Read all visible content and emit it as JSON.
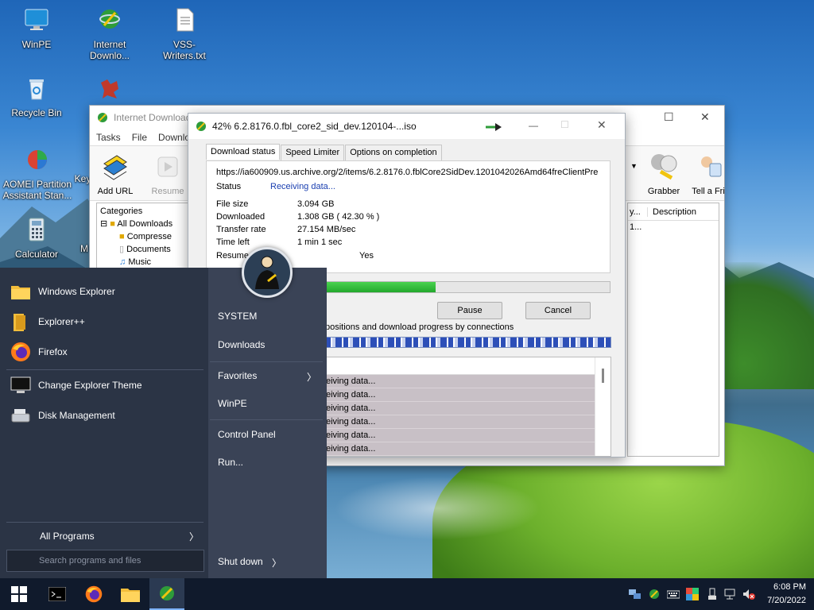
{
  "desktop": {
    "icons": [
      {
        "label": "WinPE",
        "icon": "monitor-icon"
      },
      {
        "label": "Internet Downlo...",
        "icon": "idm-globe-icon"
      },
      {
        "label": "VSS-Writers.txt",
        "icon": "text-file-icon"
      },
      {
        "label": "Recycle Bin",
        "icon": "recycle-bin-icon"
      },
      {
        "label": "",
        "icon": "puzzle-tool-icon"
      },
      {
        "label": "AOMEI Partition Assistant Stan...",
        "icon": "aomei-icon"
      },
      {
        "label": "Key",
        "icon": "key-icon"
      },
      {
        "label": "Calculator",
        "icon": "calculator-icon"
      },
      {
        "label": "M",
        "icon": "app-icon"
      }
    ]
  },
  "idm_main": {
    "title": "Internet Download",
    "menu": [
      "Tasks",
      "File",
      "Downlo"
    ],
    "toolbar": [
      {
        "label": "Add URL",
        "icon": "add-url-icon"
      },
      {
        "label": "Resume",
        "icon": "resume-icon"
      },
      {
        "label": "Grabber",
        "icon": "grabber-icon"
      },
      {
        "label": "Tell a Fri",
        "icon": "tell-friend-icon"
      }
    ],
    "categories_title": "Categories",
    "categories": [
      "All Downloads",
      "Compresse",
      "Documents",
      "Music"
    ],
    "list_headers": [
      "y...",
      "Description"
    ],
    "list_row_fragment": "1..."
  },
  "download_dialog": {
    "title": "42% 6.2.8176.0.fbl_core2_sid_dev.120104-...iso",
    "tabs": [
      "Download status",
      "Speed Limiter",
      "Options on completion"
    ],
    "url": "https://ia600909.us.archive.org/2/items/6.2.8176.0.fblCore2SidDev.1201042026Amd64freClientPre",
    "status_label": "Status",
    "status_value": "Receiving data...",
    "file_size_label": "File size",
    "file_size_value": "3.094  GB",
    "downloaded_label": "Downloaded",
    "downloaded_value": "1.308  GB  ( 42.30 % )",
    "transfer_rate_label": "Transfer rate",
    "transfer_rate_value": "27.154  MB/sec",
    "time_left_label": "Time left",
    "time_left_value": "1 min 1 sec",
    "resume_label": "Resume",
    "resume_value": "Yes",
    "progress_fraction": 0.423,
    "pause_label": "Pause",
    "cancel_label": "Cancel",
    "connections_caption": "positions and download progress by connections",
    "connection_rows": [
      "eiving data...",
      "eiving data...",
      "eiving data...",
      "eiving data...",
      "eiving data...",
      "eiving data..."
    ]
  },
  "start_menu": {
    "pinned": [
      {
        "label": "Windows Explorer",
        "icon": "folder-icon"
      },
      {
        "label": "Explorer++",
        "icon": "explorer-plus-icon"
      },
      {
        "label": "Firefox",
        "icon": "firefox-icon"
      },
      {
        "label": "Change Explorer Theme",
        "icon": "monitor-theme-icon"
      },
      {
        "label": "Disk Management",
        "icon": "disk-management-icon"
      }
    ],
    "right": [
      "SYSTEM",
      "Downloads",
      "Favorites",
      "WinPE",
      "Control Panel",
      "Run..."
    ],
    "all_programs": "All Programs",
    "search_placeholder": "Search programs and files",
    "shutdown": "Shut down"
  },
  "taskbar": {
    "apps": [
      "start-icon",
      "terminal-icon",
      "firefox-icon",
      "file-explorer-icon",
      "idm-globe-icon"
    ],
    "time": "6:08 PM",
    "date": "7/20/2022"
  }
}
